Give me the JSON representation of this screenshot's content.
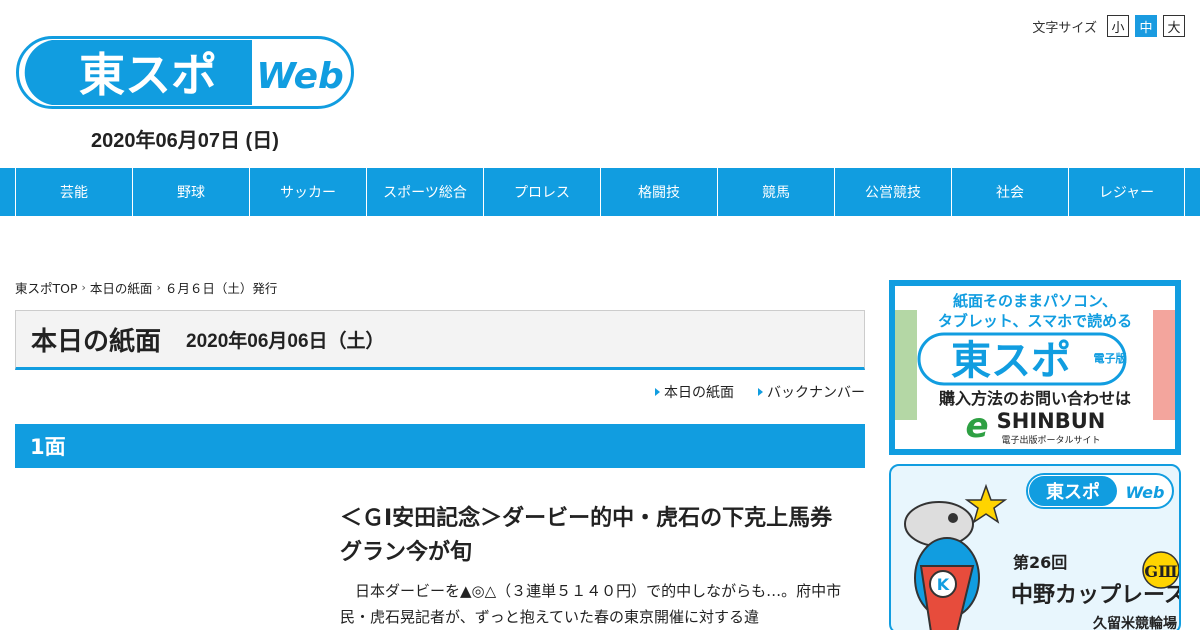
{
  "header": {
    "logo_main": "東スポ",
    "logo_sub": "Web",
    "date": "2020年06月07日 (日)",
    "font_size_label": "文字サイズ",
    "font_sizes": [
      "小",
      "中",
      "大"
    ],
    "font_size_active": "中"
  },
  "nav": {
    "items": [
      "芸能",
      "野球",
      "サッカー",
      "スポーツ総合",
      "プロレス",
      "格闘技",
      "競馬",
      "公営競技",
      "社会",
      "レジャー"
    ]
  },
  "breadcrumb": [
    "東スポTOP",
    "本日の紙面",
    "６月６日（土）発行"
  ],
  "page": {
    "title": "本日の紙面",
    "date": "2020年06月06日（土）",
    "sublinks": [
      "本日の紙面",
      "バックナンバー"
    ],
    "section": "1面"
  },
  "article": {
    "title": "＜ＧⅠ安田記念＞ダービー的中・虎石の下克上馬券　グラン今が旬",
    "body": "日本ダービーを▲◎△（３連単５１４０円）で的中しながらも…。府中市民・虎石晃記者が、ずっと抱えていた春の東京開催に対する違"
  },
  "ads": {
    "ad1": {
      "line1": "紙面そのままパソコン、",
      "line2": "タブレット、スマホで読める",
      "logo": "東スポ",
      "logo_badge": "電子版",
      "cta": "購入方法のお問い合わせは",
      "brand_e": "e",
      "brand": "SHINBUN",
      "brand_sub": "電子出版ポータルサイト"
    },
    "ad2": {
      "logo": "東スポ",
      "logo_sub": "Web",
      "edition": "第26回",
      "grade": "GⅢ",
      "race": "中野カップレース",
      "venue": "久留米競輪場"
    }
  },
  "colors": {
    "accent": "#119de0",
    "text": "#222222"
  }
}
